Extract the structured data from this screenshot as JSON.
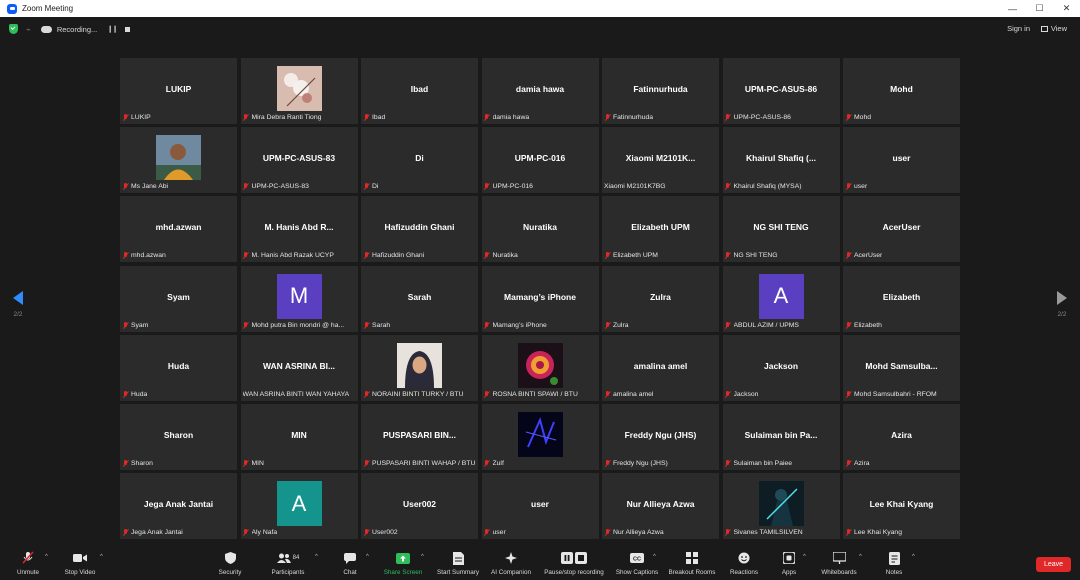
{
  "window": {
    "title": "Zoom Meeting",
    "controls": [
      "—",
      "☐",
      "✕"
    ]
  },
  "topbar": {
    "recording_label": "Recording...",
    "signin_label": "Sign in",
    "view_label": "View"
  },
  "nav": {
    "left_page": "2/2",
    "right_page": "2/2",
    "accent": "#2e8cff"
  },
  "tiles": [
    {
      "name": "LUKIP",
      "label": "LUKIP"
    },
    {
      "photo": "photo-flowers",
      "label": "Mira Debra Ranti Tiong"
    },
    {
      "name": "Ibad",
      "label": "Ibad"
    },
    {
      "name": "damia hawa",
      "label": "damia hawa"
    },
    {
      "name": "Fatinnurhuda",
      "label": "Fatinnurhuda"
    },
    {
      "name": "UPM-PC-ASUS-86",
      "label": "UPM-PC-ASUS-86"
    },
    {
      "name": "Mohd",
      "label": "Mohd"
    },
    {
      "photo": "photo-person",
      "label": "Ms Jane Abi"
    },
    {
      "name": "UPM-PC-ASUS-83",
      "label": "UPM-PC-ASUS-83"
    },
    {
      "name": "Di",
      "label": "Di"
    },
    {
      "name": "UPM-PC-016",
      "label": "UPM-PC-016"
    },
    {
      "name": "Xiaomi  M2101K...",
      "label": "Xiaomi M2101K7BG",
      "nomic": true
    },
    {
      "name": "Khairul Shafiq (...",
      "label": "Khairul Shafiq (MYSA)"
    },
    {
      "name": "user",
      "label": "user"
    },
    {
      "name": "mhd.azwan",
      "label": "mhd.azwan"
    },
    {
      "name": "M. Hanis Abd R...",
      "label": "M. Hanis Abd Razak UCYP"
    },
    {
      "name": "Hafizuddin Ghani",
      "label": "Hafizuddin Ghani"
    },
    {
      "name": "Nuratika",
      "label": "Nuratika"
    },
    {
      "name": "Elizabeth  UPM",
      "label": "Elizabeth  UPM"
    },
    {
      "name": "NG SHI TENG",
      "label": "NG SHI TENG"
    },
    {
      "name": "AcerUser",
      "label": "AcerUser"
    },
    {
      "name": "Syam",
      "label": "Syam"
    },
    {
      "letter": "M",
      "color": "#5a3fc0",
      "label": "Mohd putra Bin mondri @ ha..."
    },
    {
      "name": "Sarah",
      "label": "Sarah"
    },
    {
      "name": "Mamang’s iPhone",
      "label": "Mamang’s iPhone"
    },
    {
      "name": "Zulra",
      "label": "Zulra"
    },
    {
      "letter": "A",
      "color": "#5a3fc0",
      "label": "ABDUL AZIM / UPMS"
    },
    {
      "name": "Elizabeth",
      "label": "Elizabeth"
    },
    {
      "name": "Huda",
      "label": "Huda"
    },
    {
      "name": "WAN ASRINA BI...",
      "label": "WAN ASRINA BINTI WAN YAHAYA",
      "nomic": true
    },
    {
      "photo": "photo-hijab",
      "label": "NORAINI BINTI TURKY / BTU"
    },
    {
      "photo": "photo-rose",
      "label": "ROSNA BINTI SPAWI / BTU"
    },
    {
      "name": "amalina amel",
      "label": "amalina amel"
    },
    {
      "name": "Jackson",
      "label": "Jackson"
    },
    {
      "name": "Mohd  Samsulba...",
      "label": "Mohd Samsulbahri - RFOM"
    },
    {
      "name": "Sharon",
      "label": "Sharon"
    },
    {
      "name": "MIN",
      "label": "MIN"
    },
    {
      "name": "PUSPASARI  BIN...",
      "label": "PUSPASARI BINTI WAHAP / BTU"
    },
    {
      "photo": "photo-abstract",
      "label": "Zulf"
    },
    {
      "name": "Freddy Ngu (JHS)",
      "label": "Freddy Ngu (JHS)"
    },
    {
      "name": "Sulaiman  bin  Pa...",
      "label": "Sulaiman bin Paiee"
    },
    {
      "name": "Azira",
      "label": "Azira"
    },
    {
      "name": "Jega Anak Jantai",
      "label": "Jega Anak Jantai"
    },
    {
      "letter": "A",
      "color": "#14948c",
      "label": "Aly Nafa"
    },
    {
      "name": "User002",
      "label": "User002"
    },
    {
      "name": "user",
      "label": "user"
    },
    {
      "name": "Nur Allieya Azwa",
      "label": "Nur Allieya Azwa"
    },
    {
      "photo": "photo-warrior",
      "label": "Sivanes TAMILSILVEN"
    },
    {
      "name": "Lee Khai Kyang",
      "label": "Lee Khai Kyang"
    }
  ],
  "toolbar": {
    "items": [
      {
        "id": "unmute",
        "label": "Unmute",
        "icon": "mic-muted-icon"
      },
      {
        "id": "stop-video",
        "label": "Stop Video",
        "icon": "video-icon"
      },
      {
        "id": "security",
        "label": "Security",
        "icon": "shield-icon"
      },
      {
        "id": "participants",
        "label": "Participants",
        "icon": "participants-icon",
        "count": "84"
      },
      {
        "id": "chat",
        "label": "Chat",
        "icon": "chat-icon"
      },
      {
        "id": "share-screen",
        "label": "Share Screen",
        "icon": "share-screen-icon"
      },
      {
        "id": "start-summary",
        "label": "Start Summary",
        "icon": "summary-icon"
      },
      {
        "id": "ai-companion",
        "label": "AI Companion",
        "icon": "ai-companion-icon"
      },
      {
        "id": "pause-stop-recording",
        "label": "Pause/stop recording",
        "icon": "recording-controls-icon"
      },
      {
        "id": "show-captions",
        "label": "Show Captions",
        "icon": "captions-icon"
      },
      {
        "id": "breakout-rooms",
        "label": "Breakout Rooms",
        "icon": "breakout-rooms-icon"
      },
      {
        "id": "reactions",
        "label": "Reactions",
        "icon": "reactions-icon"
      },
      {
        "id": "apps",
        "label": "Apps",
        "icon": "apps-icon"
      },
      {
        "id": "whiteboards",
        "label": "Whiteboards",
        "icon": "whiteboard-icon"
      },
      {
        "id": "notes",
        "label": "Notes",
        "icon": "notes-icon"
      }
    ],
    "leave_label": "Leave",
    "share_color": "#2ebd59",
    "leave_color": "#e02828"
  }
}
